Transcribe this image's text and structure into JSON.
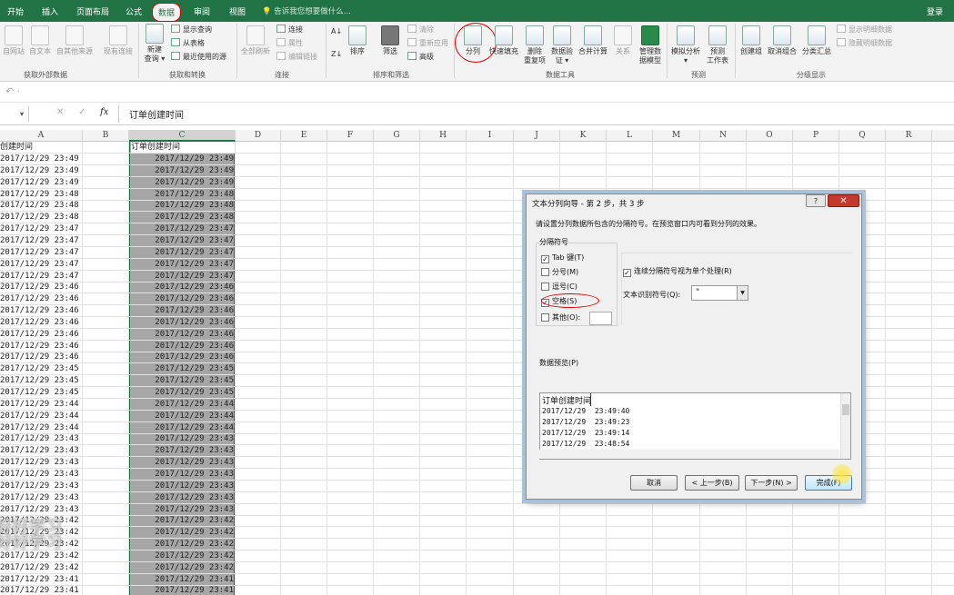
{
  "tabs": [
    "开始",
    "插入",
    "页面布局",
    "公式",
    "数据",
    "审阅",
    "视图"
  ],
  "tell_me": "告诉我您想要做什么...",
  "login": "登录",
  "ribbon": {
    "btn_from_web": "自网站",
    "btn_from_text": "自文本",
    "btn_other_src": "自其他来源",
    "btn_existing": "现有连接",
    "btn_new_query": "新建",
    "btn_new_query2": "查询 ▾",
    "show_query": "显示查询",
    "from_table": "从表格",
    "recent_src": "最近使用的源",
    "refresh_all": "全部刷新",
    "connections": "连接",
    "properties": "属性",
    "edit_links": "编辑链接",
    "sort": "排序",
    "filter": "筛选",
    "clear": "清除",
    "reapply": "重新应用",
    "advanced": "高级",
    "split": "分列",
    "flash_fill": "快速填充",
    "remove_dup": "删除",
    "remove_dup2": "重复项",
    "validation": "数据验",
    "validation2": "证 ▾",
    "consolidate": "合并计算",
    "relations": "关系",
    "manage_model": "管理数",
    "manage_model2": "据模型",
    "whatif": "模拟分析",
    "whatif2": "▾",
    "forecast": "预测",
    "forecast2": "工作表",
    "group": "创建组",
    "ungroup": "取消组合",
    "subtotal": "分类汇总",
    "show_detail": "显示明细数据",
    "hide_detail": "隐藏明细数据",
    "g_external": "获取外部数据",
    "g_transform": "获取和转换",
    "g_conn": "连接",
    "g_sort": "排序和筛选",
    "g_tools": "数据工具",
    "g_forecast": "预测",
    "g_outline": "分级显示"
  },
  "undo_icon": "↶ ·",
  "formula": {
    "namebox": "▾",
    "cancel": "✕",
    "enter": "✓",
    "fx": "fx",
    "content": "订单创建时间"
  },
  "columns": [
    "A",
    "B",
    "C",
    "D",
    "E",
    "F",
    "G",
    "H",
    "I",
    "J",
    "K",
    "L",
    "M",
    "N",
    "O",
    "P",
    "Q",
    "R"
  ],
  "grid": {
    "header_a": "创建时间",
    "header_c": "订单创建时间",
    "rows": [
      [
        "2017/12/29 23:49",
        "2017/12/29 23:49"
      ],
      [
        "2017/12/29 23:49",
        "2017/12/29 23:49"
      ],
      [
        "2017/12/29 23:49",
        "2017/12/29 23:49"
      ],
      [
        "2017/12/29 23:48",
        "2017/12/29 23:48"
      ],
      [
        "2017/12/29 23:48",
        "2017/12/29 23:48"
      ],
      [
        "2017/12/29 23:48",
        "2017/12/29 23:48"
      ],
      [
        "2017/12/29 23:47",
        "2017/12/29 23:47"
      ],
      [
        "2017/12/29 23:47",
        "2017/12/29 23:47"
      ],
      [
        "2017/12/29 23:47",
        "2017/12/29 23:47"
      ],
      [
        "2017/12/29 23:47",
        "2017/12/29 23:47"
      ],
      [
        "2017/12/29 23:47",
        "2017/12/29 23:47"
      ],
      [
        "2017/12/29 23:46",
        "2017/12/29 23:46"
      ],
      [
        "2017/12/29 23:46",
        "2017/12/29 23:46"
      ],
      [
        "2017/12/29 23:46",
        "2017/12/29 23:46"
      ],
      [
        "2017/12/29 23:46",
        "2017/12/29 23:46"
      ],
      [
        "2017/12/29 23:46",
        "2017/12/29 23:46"
      ],
      [
        "2017/12/29 23:46",
        "2017/12/29 23:46"
      ],
      [
        "2017/12/29 23:46",
        "2017/12/29 23:46"
      ],
      [
        "2017/12/29 23:45",
        "2017/12/29 23:45"
      ],
      [
        "2017/12/29 23:45",
        "2017/12/29 23:45"
      ],
      [
        "2017/12/29 23:45",
        "2017/12/29 23:45"
      ],
      [
        "2017/12/29 23:44",
        "2017/12/29 23:44"
      ],
      [
        "2017/12/29 23:44",
        "2017/12/29 23:44"
      ],
      [
        "2017/12/29 23:44",
        "2017/12/29 23:44"
      ],
      [
        "2017/12/29 23:43",
        "2017/12/29 23:43"
      ],
      [
        "2017/12/29 23:43",
        "2017/12/29 23:43"
      ],
      [
        "2017/12/29 23:43",
        "2017/12/29 23:43"
      ],
      [
        "2017/12/29 23:43",
        "2017/12/29 23:43"
      ],
      [
        "2017/12/29 23:43",
        "2017/12/29 23:43"
      ],
      [
        "2017/12/29 23:43",
        "2017/12/29 23:43"
      ],
      [
        "2017/12/29 23:43",
        "2017/12/29 23:43"
      ],
      [
        "2017/12/29 23:42",
        "2017/12/29 23:42"
      ],
      [
        "2017/12/29 23:42",
        "2017/12/29 23:42"
      ],
      [
        "2017/12/29 23:42",
        "2017/12/29 23:42"
      ],
      [
        "2017/12/29 23:42",
        "2017/12/29 23:42"
      ],
      [
        "2017/12/29 23:42",
        "2017/12/29 23:42"
      ],
      [
        "2017/12/29 23:41",
        "2017/12/29 23:41"
      ],
      [
        "2017/12/29 23:41",
        "2017/12/29 23:41"
      ]
    ]
  },
  "watermark": "好好学习",
  "dialog": {
    "title": "文本分列向导 - 第 2 步，共 3 步",
    "help": "?",
    "close": "✕",
    "desc": "请设置分列数据所包含的分隔符号。在预览窗口内可看到分列的效果。",
    "group_title": "分隔符号",
    "tab": "Tab 键(T)",
    "semicolon": "分号(M)",
    "comma": "逗号(C)",
    "space": "空格(S)",
    "other": "其他(O):",
    "check": "✓",
    "consecutive": "连续分隔符号视为单个处理(R)",
    "qualifier_label": "文本识别符号(Q):",
    "qualifier_value": "\"",
    "qualifier_arrow": "▼",
    "preview_title": "数据预览(P)",
    "preview_header": "订单创建时间",
    "preview_rows": [
      [
        "2017/12/29",
        "23:49:40"
      ],
      [
        "2017/12/29",
        "23:49:23"
      ],
      [
        "2017/12/29",
        "23:49:14"
      ],
      [
        "2017/12/29",
        "23:48:54"
      ]
    ],
    "cancel": "取消",
    "back": "< 上一步(B)",
    "next": "下一步(N) >",
    "finish": "完成(F)"
  }
}
